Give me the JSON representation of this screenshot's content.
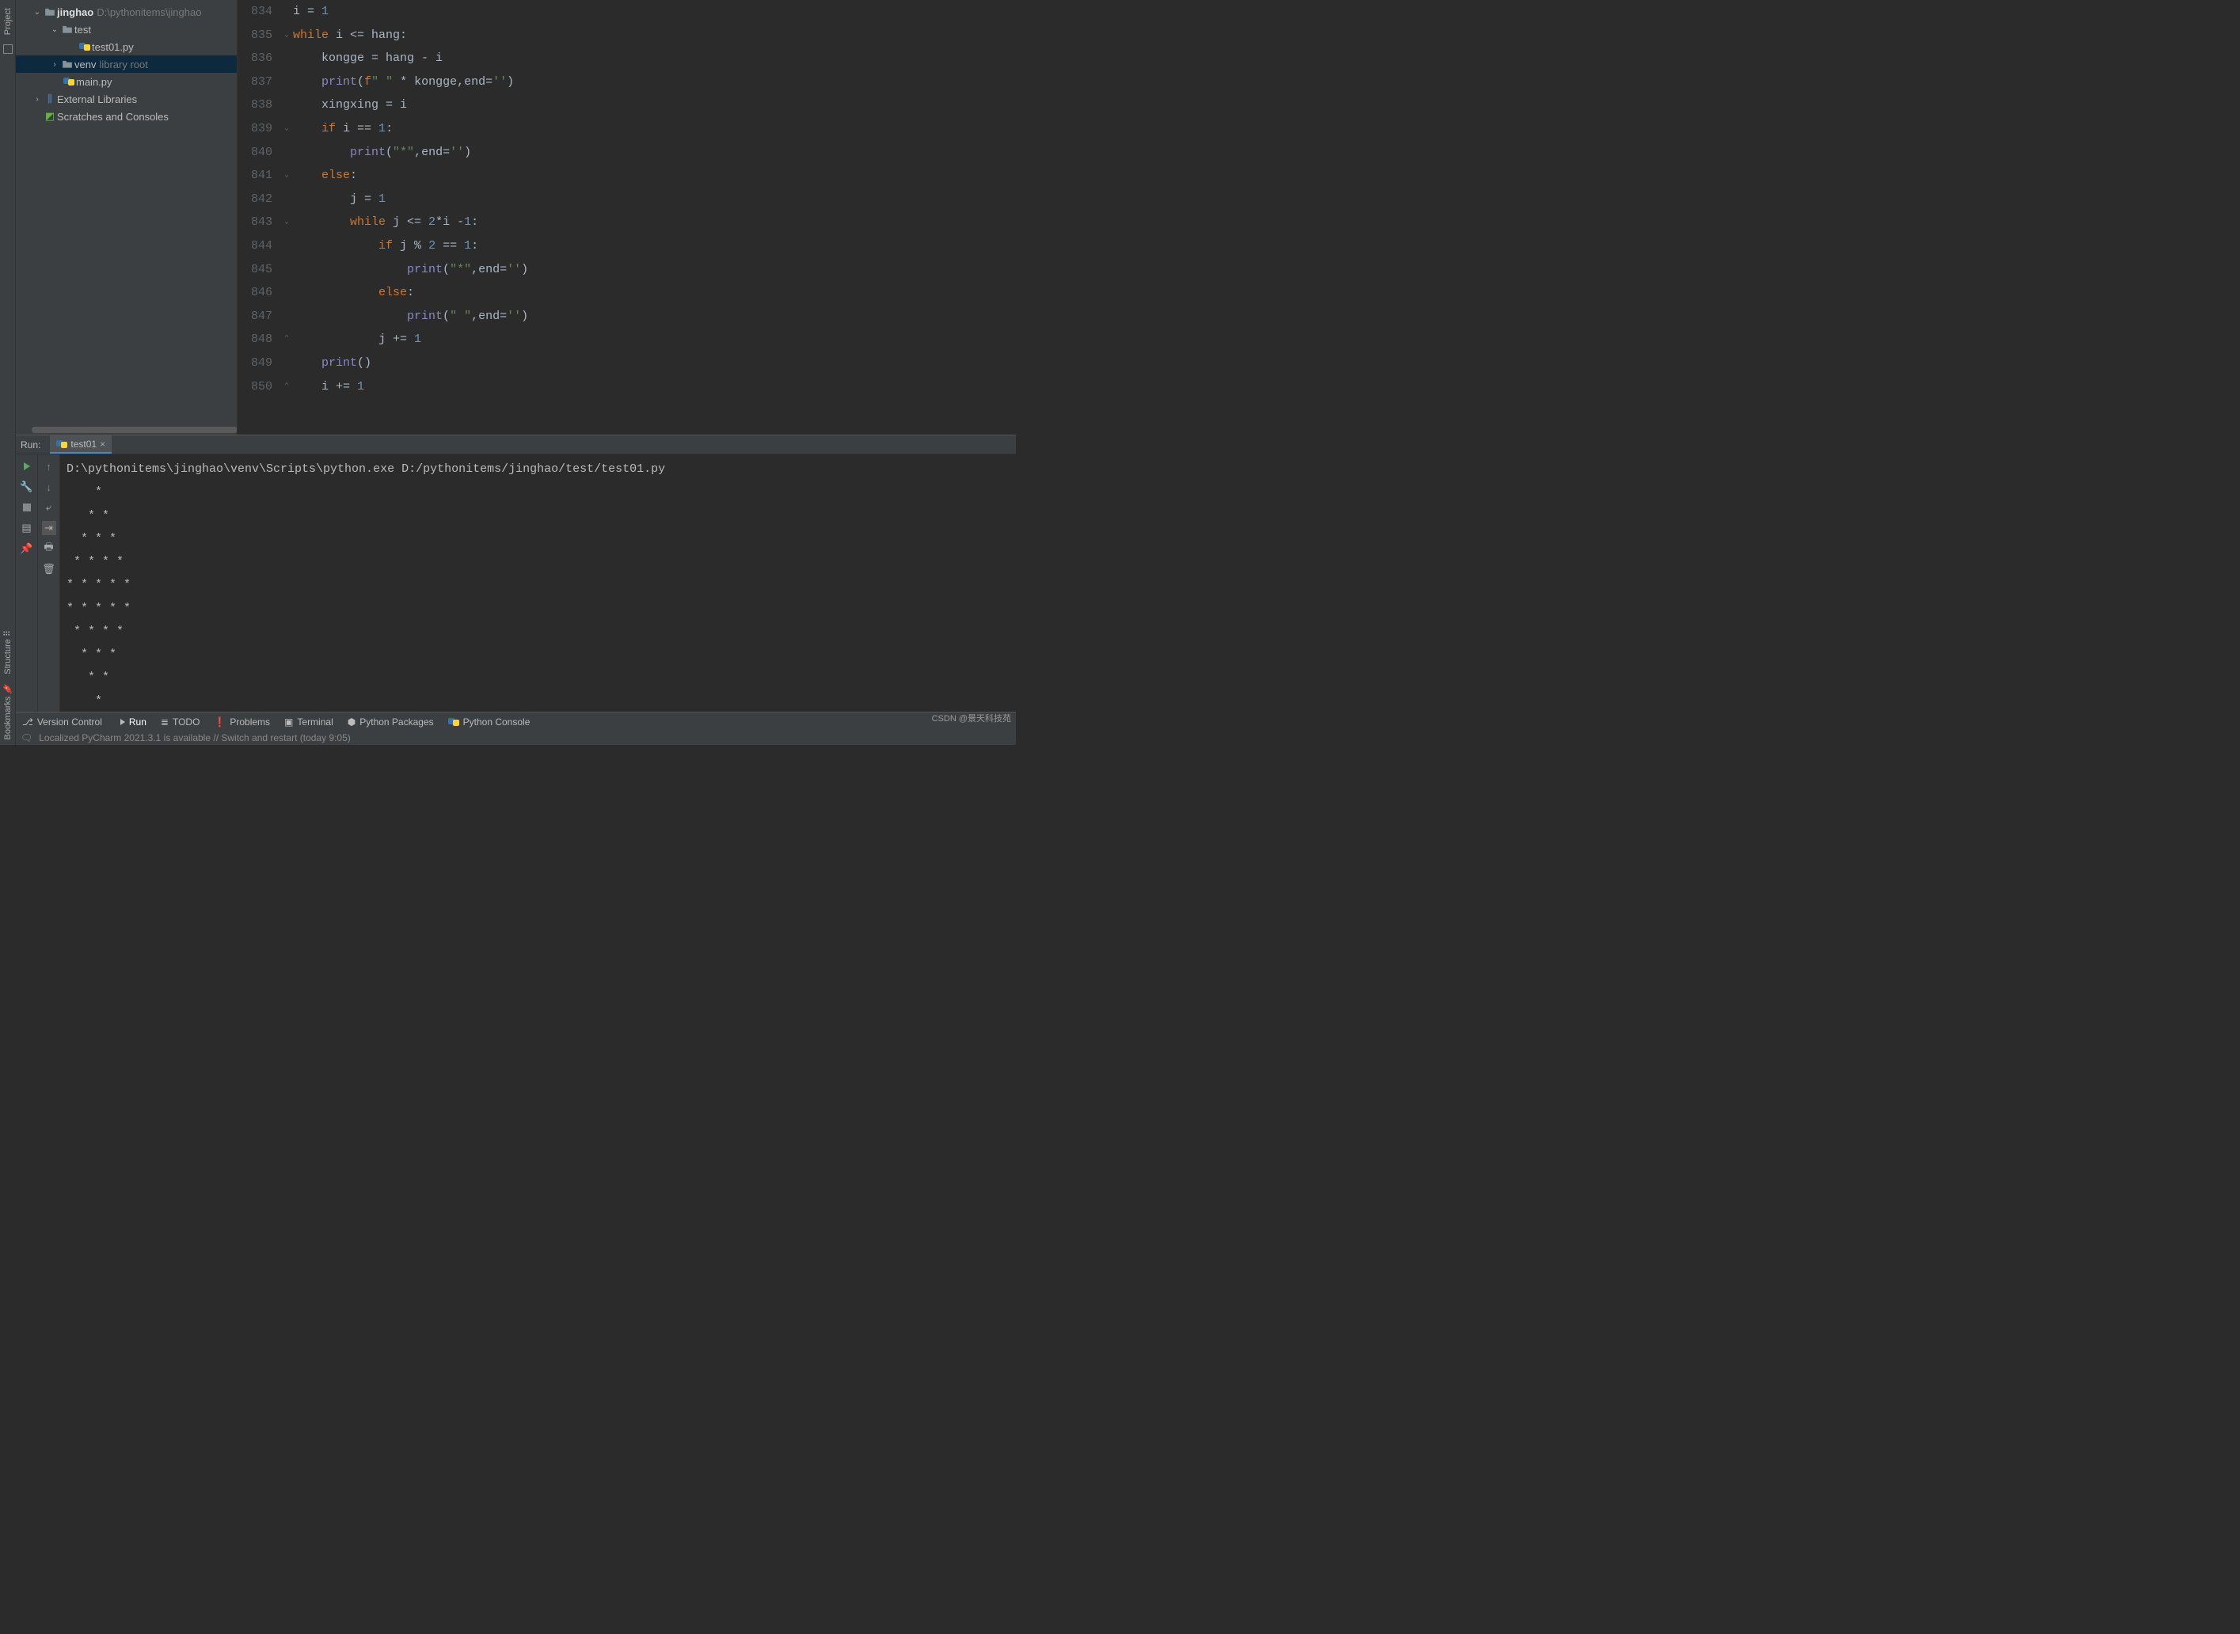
{
  "left_gutter": {
    "top_label": "Project",
    "structure_label": "Structure",
    "bookmarks_label": "Bookmarks"
  },
  "project_tree": {
    "root": {
      "name": "jinghao",
      "path": "D:\\pythonitems\\jinghao"
    },
    "test_folder": "test",
    "test_file": "test01.py",
    "venv": {
      "name": "venv",
      "hint": "library root"
    },
    "main_file": "main.py",
    "external": "External Libraries",
    "scratches": "Scratches and Consoles"
  },
  "editor": {
    "lines": [
      {
        "n": 834,
        "fold": "",
        "html": "i = <span class='num'>1</span>",
        "indent": 0
      },
      {
        "n": 835,
        "fold": "⌄",
        "html": "<span class='kw'>while</span> i &lt;= hang:",
        "indent": 0
      },
      {
        "n": 836,
        "fold": "",
        "html": "kongge = hang - i",
        "indent": 1
      },
      {
        "n": 837,
        "fold": "",
        "html": "<span class='fn'>print</span>(<span class='kw'>f</span><span class='str'>\" \"</span> * kongge,<span class='op'>end</span>=<span class='str'>''</span>)",
        "indent": 1
      },
      {
        "n": 838,
        "fold": "",
        "html": "xingxing = i",
        "indent": 1
      },
      {
        "n": 839,
        "fold": "⌄",
        "html": "<span class='kw'>if</span> i == <span class='num'>1</span>:",
        "indent": 1
      },
      {
        "n": 840,
        "fold": "",
        "html": "<span class='fn'>print</span>(<span class='str'>\"*\"</span>,<span class='op'>end</span>=<span class='str'>''</span>)",
        "indent": 2
      },
      {
        "n": 841,
        "fold": "⌄",
        "html": "<span class='kw'>else</span>:",
        "indent": 1
      },
      {
        "n": 842,
        "fold": "",
        "html": "j = <span class='num'>1</span>",
        "indent": 2
      },
      {
        "n": 843,
        "fold": "⌄",
        "html": "<span class='kw'>while</span> j &lt;= <span class='num'>2</span>*i -<span class='num'>1</span>:",
        "indent": 2
      },
      {
        "n": 844,
        "fold": "",
        "html": "<span class='kw'>if</span> j % <span class='num'>2</span> == <span class='num'>1</span>:",
        "indent": 3
      },
      {
        "n": 845,
        "fold": "",
        "html": "<span class='fn'>print</span>(<span class='str'>\"*\"</span>,<span class='op'>end</span>=<span class='str'>''</span>)",
        "indent": 4
      },
      {
        "n": 846,
        "fold": "",
        "html": "<span class='kw'>else</span>:",
        "indent": 3
      },
      {
        "n": 847,
        "fold": "",
        "html": "<span class='fn'>print</span>(<span class='str'>\" \"</span>,<span class='op'>end</span>=<span class='str'>''</span>)",
        "indent": 4
      },
      {
        "n": 848,
        "fold": "⌃",
        "html": "j += <span class='num'>1</span>",
        "indent": 3
      },
      {
        "n": 849,
        "fold": "",
        "html": "<span class='fn'>print</span>()",
        "indent": 1
      },
      {
        "n": 850,
        "fold": "⌃",
        "html": "i += <span class='num'>1</span>",
        "indent": 1
      }
    ]
  },
  "run": {
    "header_label": "Run:",
    "tab_name": "test01",
    "command": "D:\\pythonitems\\jinghao\\venv\\Scripts\\python.exe D:/pythonitems/jinghao/test/test01.py",
    "output_lines": [
      "    *",
      "   * *",
      "  * * *",
      " * * * *",
      "* * * * *",
      "* * * * *",
      " * * * *",
      "  * * *",
      "   * *",
      "    *"
    ]
  },
  "bottom_toolbar": {
    "version_control": "Version Control",
    "run": "Run",
    "todo": "TODO",
    "problems": "Problems",
    "terminal": "Terminal",
    "python_packages": "Python Packages",
    "python_console": "Python Console"
  },
  "status_bar": {
    "message": "Localized PyCharm 2021.3.1 is available // Switch and restart (today 9:05)"
  },
  "watermark": "CSDN @景天科技苑"
}
